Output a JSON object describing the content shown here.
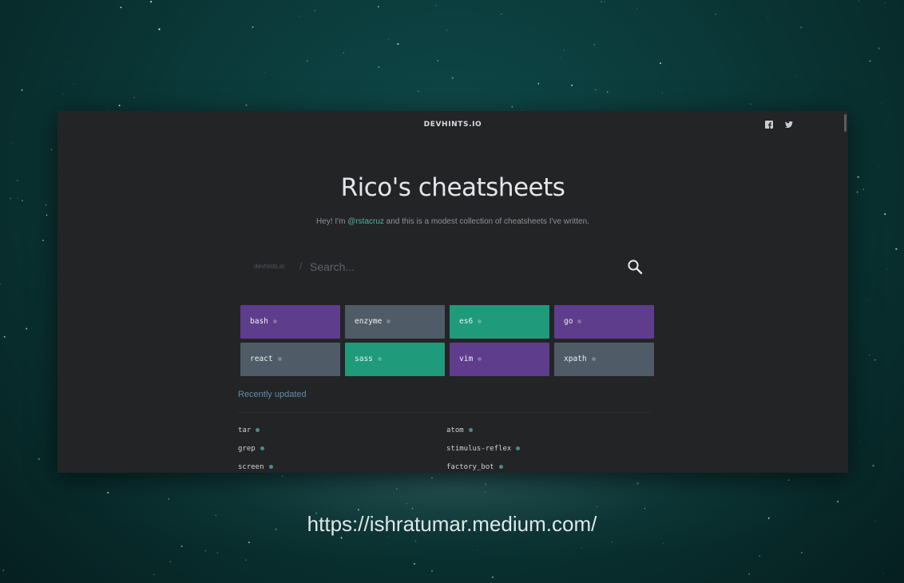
{
  "site": {
    "brand": "DEVHINTS.IO",
    "social": [
      "facebook-icon",
      "twitter-icon"
    ]
  },
  "hero": {
    "title": "Rico's cheatsheets",
    "subtitle_prefix": "Hey! I'm ",
    "subtitle_handle": "@rstacruz",
    "subtitle_suffix": " and this is a modest collection of cheatsheets I've written."
  },
  "search": {
    "prefix": "devhints.io",
    "separator": "/",
    "placeholder": "Search...",
    "value": ""
  },
  "colors": {
    "purple": "#5d3d8c",
    "slate": "#4f5b66",
    "teal": "#1f9a7b",
    "accent_link": "#4fb3a6",
    "section_title": "#5d8fa6"
  },
  "cards": [
    {
      "label": "bash",
      "color": "#5d3d8c"
    },
    {
      "label": "enzyme",
      "color": "#4f5b66"
    },
    {
      "label": "es6",
      "color": "#1f9a7b"
    },
    {
      "label": "go",
      "color": "#5d3d8c"
    },
    {
      "label": "react",
      "color": "#4f5b66"
    },
    {
      "label": "sass",
      "color": "#1f9a7b"
    },
    {
      "label": "vim",
      "color": "#5d3d8c"
    },
    {
      "label": "xpath",
      "color": "#4f5b66"
    }
  ],
  "recent": {
    "title": "Recently updated",
    "left": [
      "tar",
      "grep",
      "screen"
    ],
    "right": [
      "atom",
      "stimulus-reflex",
      "factory_bot"
    ]
  },
  "caption": "https://ishratumar.medium.com/"
}
